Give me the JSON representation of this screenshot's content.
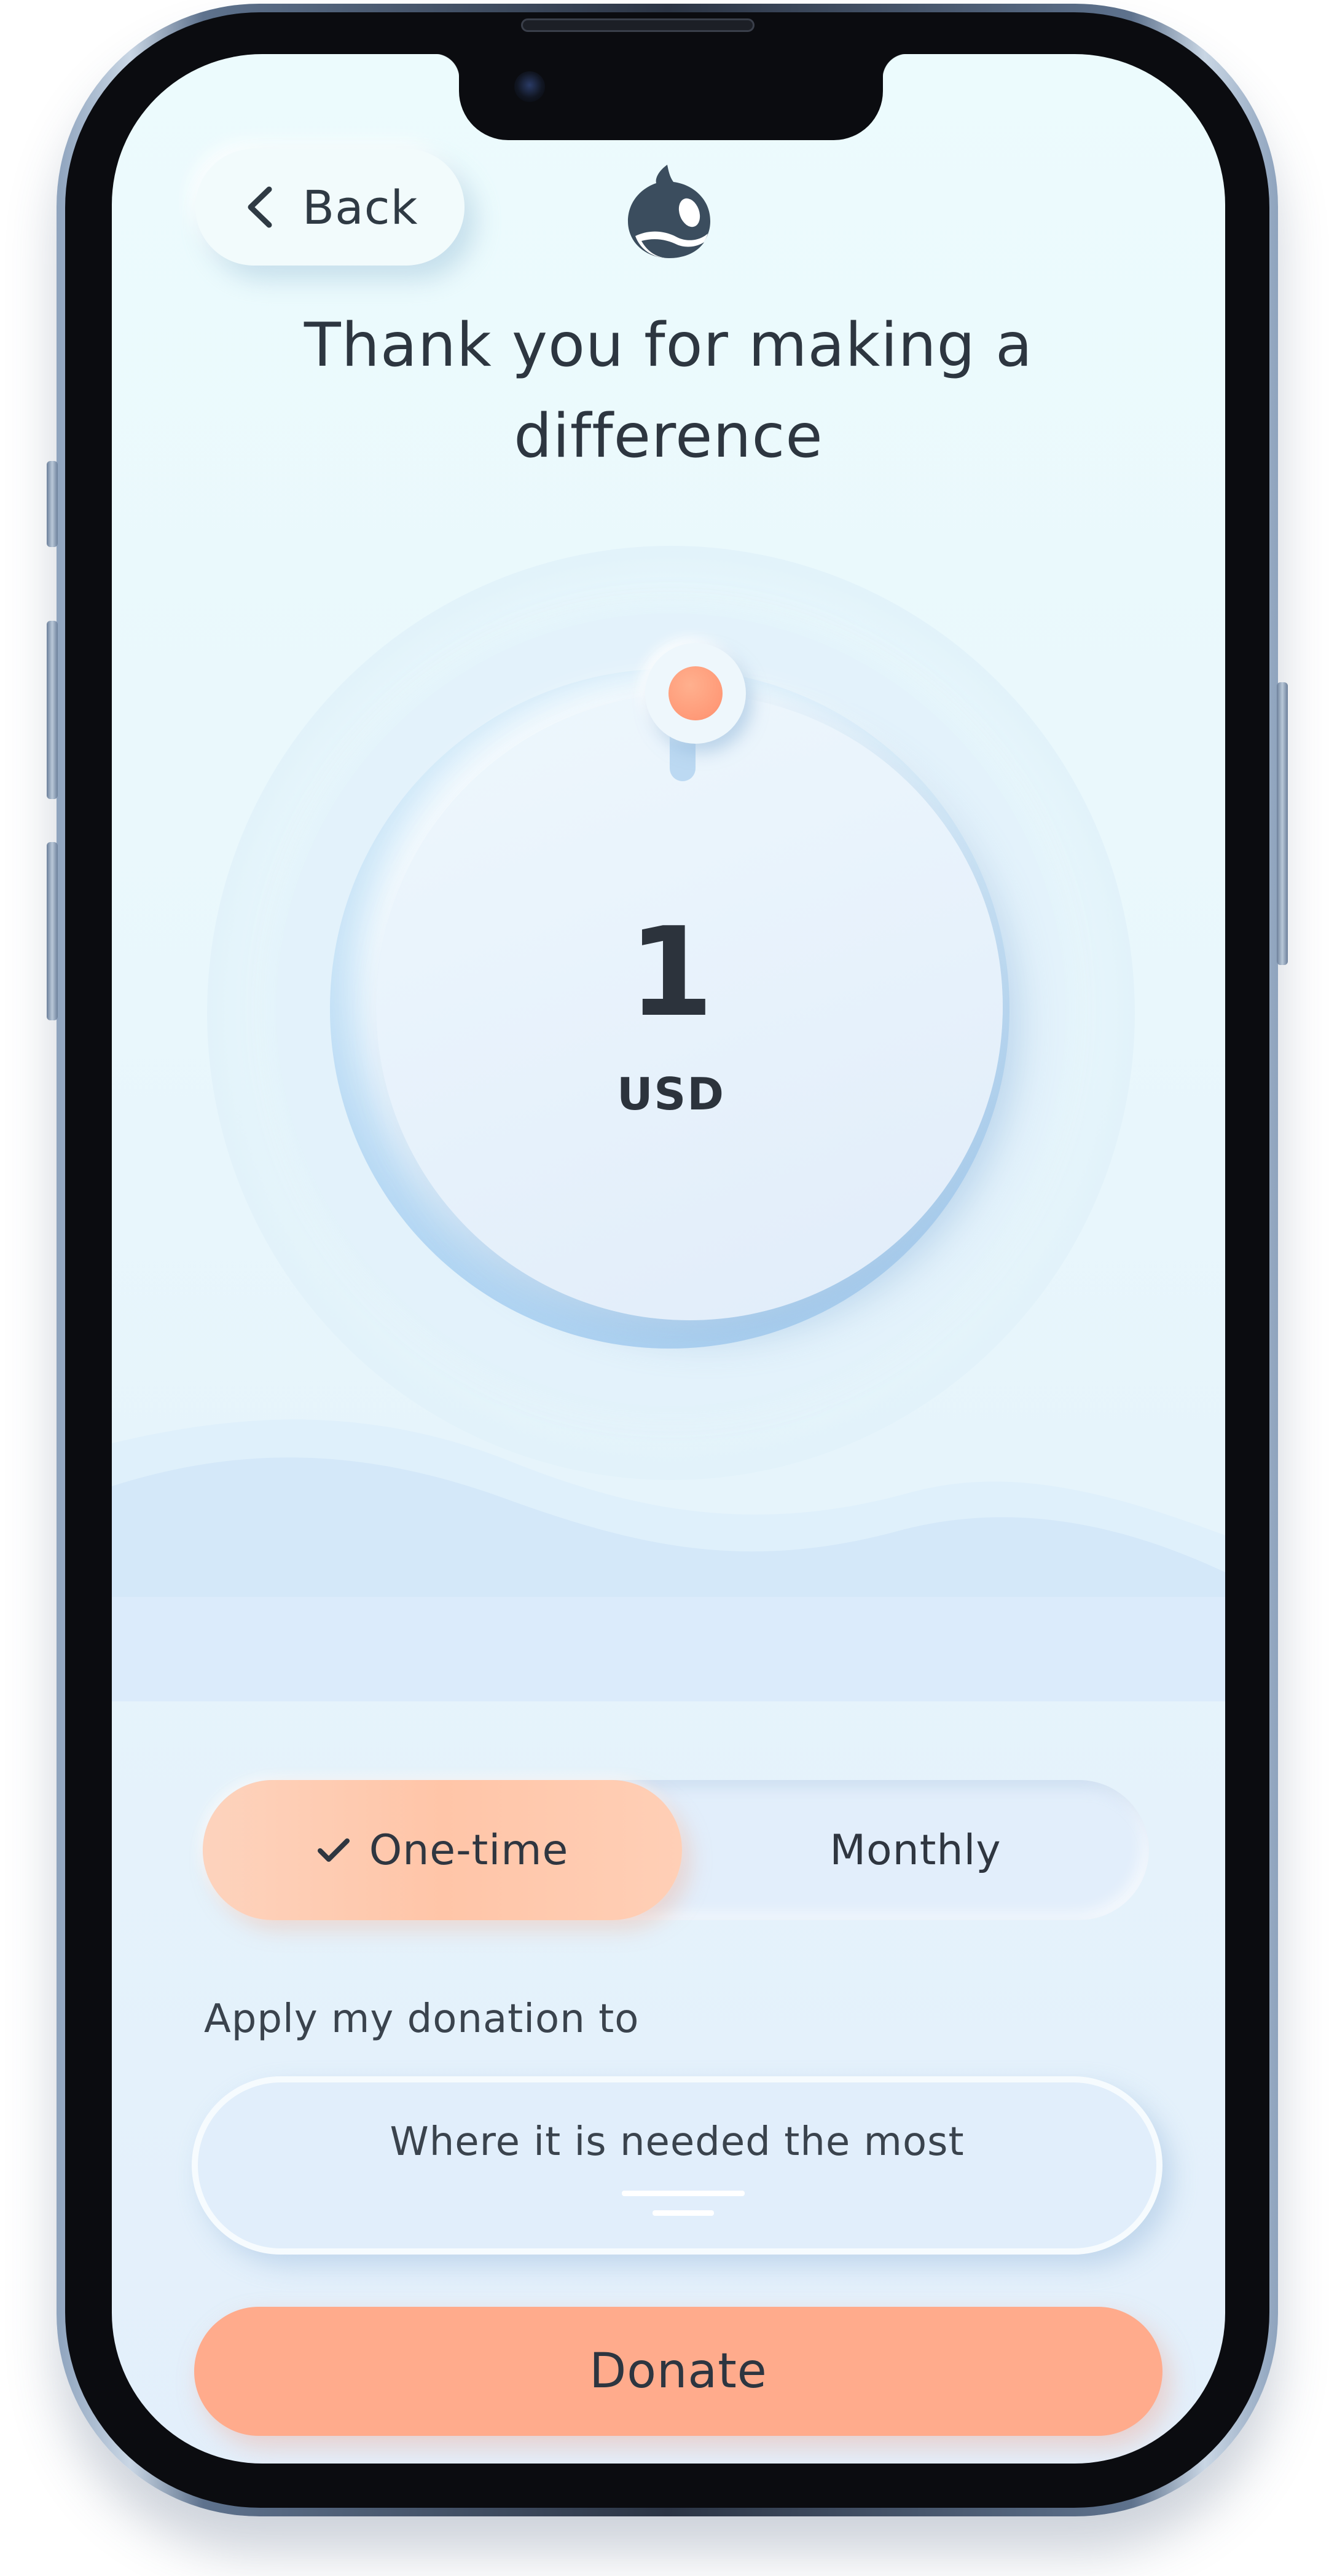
{
  "header": {
    "back_label": "Back",
    "title": "Thank you for making a difference"
  },
  "amount": {
    "value": "1",
    "currency": "USD"
  },
  "frequency": {
    "options": [
      "One-time",
      "Monthly"
    ],
    "selected": "One-time"
  },
  "allocation": {
    "label": "Apply my donation to",
    "value": "Where it is needed the most"
  },
  "actions": {
    "donate_label": "Donate"
  },
  "colors": {
    "accent": "#ffab8c",
    "accent_knob": "#ff9a78",
    "text": "#2d3640",
    "background": "#e6f4fb"
  },
  "icons": {
    "back": "chevron-left-icon",
    "logo": "orca-logo",
    "check": "check-icon",
    "select": "menu-lines-icon"
  }
}
